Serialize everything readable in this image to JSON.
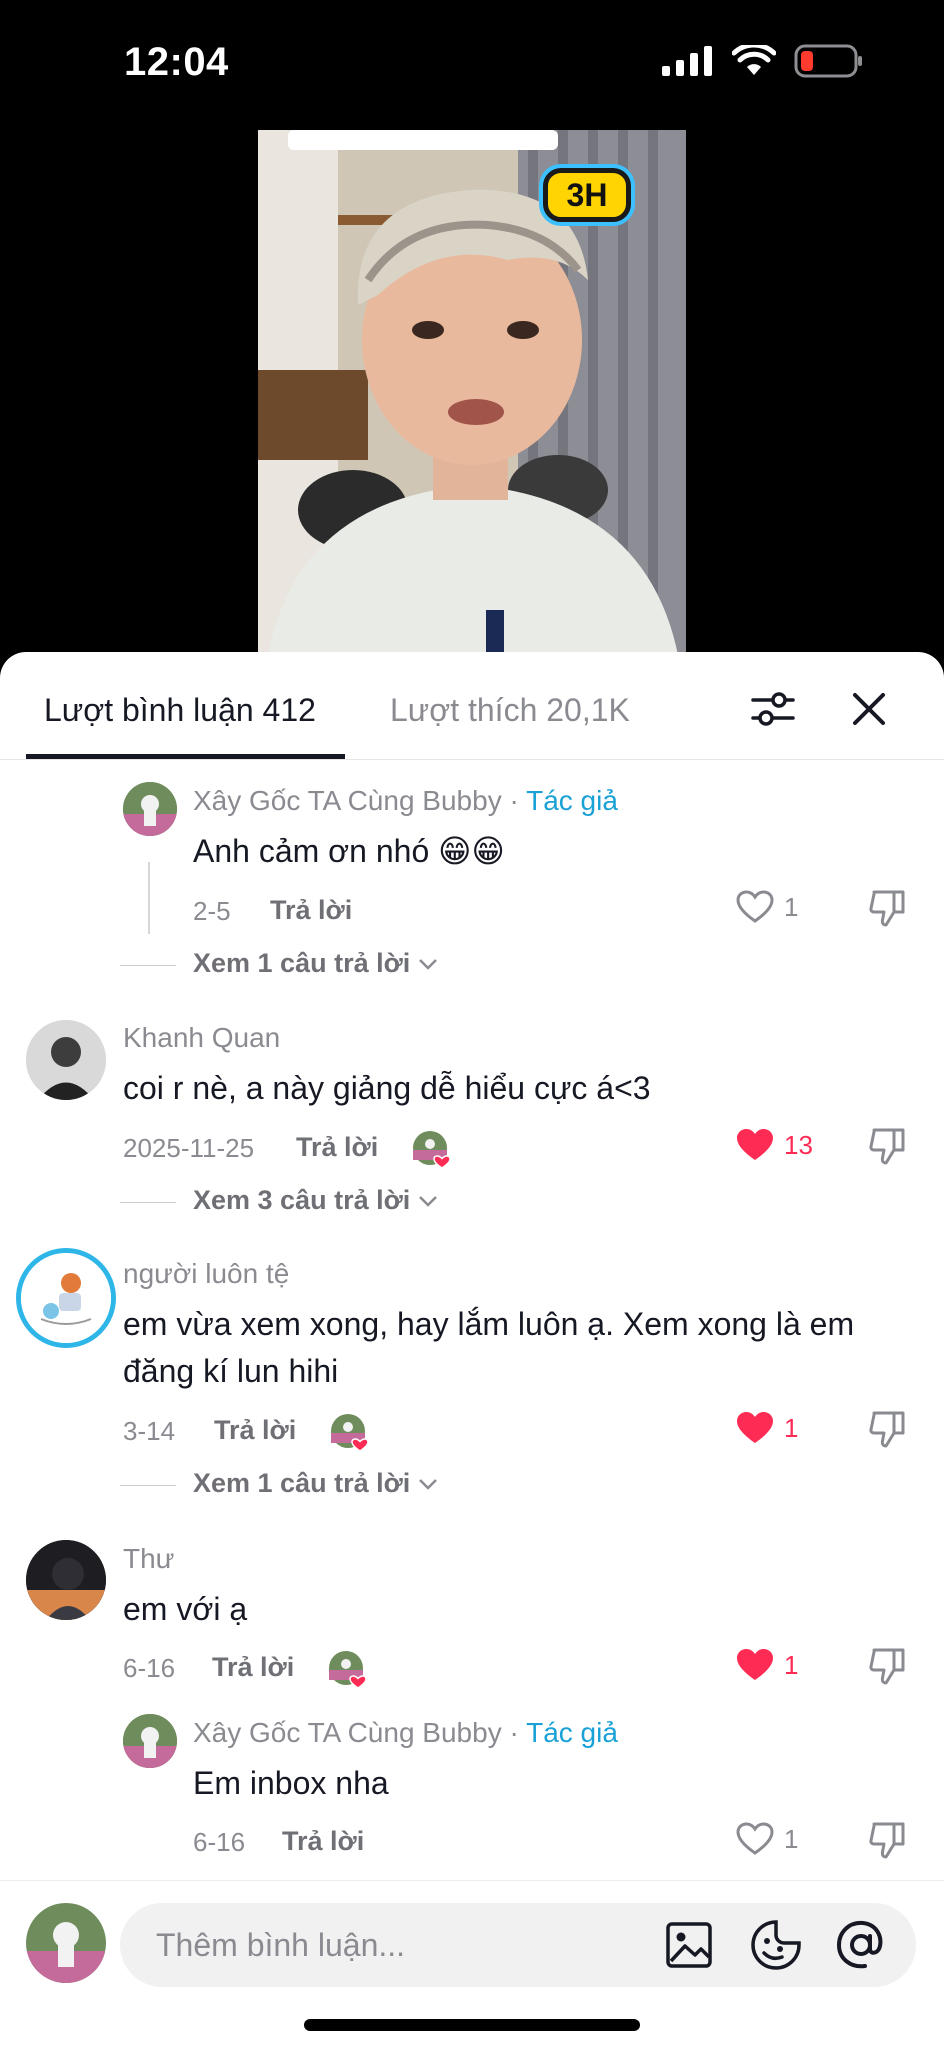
{
  "status": {
    "time": "12:04"
  },
  "video": {
    "badge": "3H"
  },
  "tabs": {
    "comments": "Lượt bình luận 412",
    "likes": "Lượt thích 20,1K"
  },
  "comments": [
    {
      "user": "Xây Gốc TA Cùng Bubby",
      "author_sep": " · ",
      "author_tag": "Tác giả",
      "text": "Anh cảm ơn nhó 😁😁",
      "date": "2-5",
      "reply": "Trả lời",
      "likes": "1",
      "liked": false,
      "more": "Xem 1 câu trả lời"
    },
    {
      "user": "Khanh Quan",
      "text": "coi r nè, a này giảng dễ hiểu cực á<3",
      "date": "2025-11-25",
      "reply": "Trả lời",
      "likes": "13",
      "liked": true,
      "more": "Xem 3 câu trả lời"
    },
    {
      "user": "người luôn tệ",
      "text_line1": "em vừa xem xong, hay lắm luôn ạ. Xem xong là em",
      "text_line2": "đăng kí lun hihi",
      "date": "3-14",
      "reply": "Trả lời",
      "likes": "1",
      "liked": true,
      "more": "Xem 1 câu trả lời"
    },
    {
      "user": "Thư",
      "text": "em với ạ",
      "date": "6-16",
      "reply": "Trả lời",
      "likes": "1",
      "liked": true
    },
    {
      "user": "Xây Gốc TA Cùng Bubby",
      "author_sep": " · ",
      "author_tag": "Tác giả",
      "text": "Em inbox nha",
      "date": "6-16",
      "reply": "Trả lời",
      "likes": "1",
      "liked": false
    }
  ],
  "composer": {
    "placeholder": "Thêm bình luận..."
  },
  "colors": {
    "accent_red": "#fe2c55",
    "author_blue": "#1aa1d6"
  }
}
